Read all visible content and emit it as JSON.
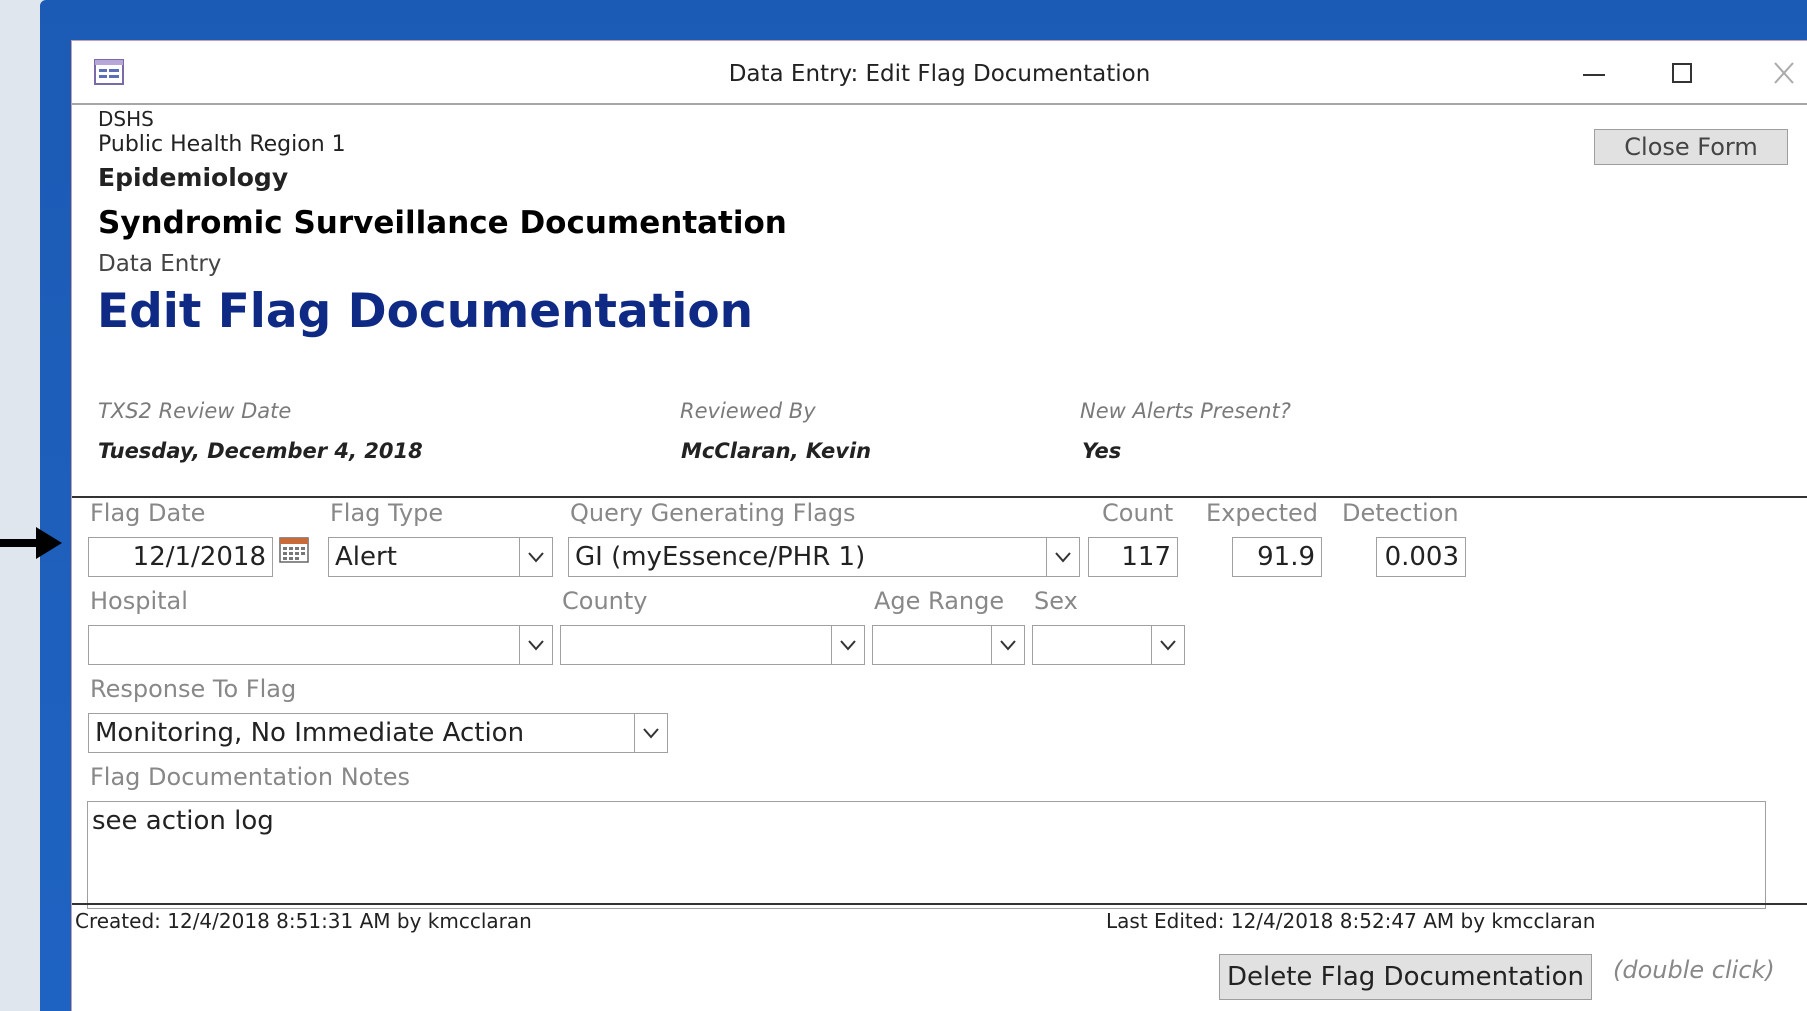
{
  "window": {
    "title": "Data Entry: Edit Flag Documentation"
  },
  "header": {
    "org": "DSHS",
    "region": "Public Health Region 1",
    "department": "Epidemiology",
    "system": "Syndromic Surveillance Documentation",
    "section": "Data Entry",
    "page_title": "Edit Flag Documentation",
    "close_button": "Close Form"
  },
  "review": {
    "review_date_label": "TXS2 Review Date",
    "review_date_value": "Tuesday, December 4, 2018",
    "reviewed_by_label": "Reviewed By",
    "reviewed_by_value": "McClaran, Kevin",
    "new_alerts_label": "New Alerts Present?",
    "new_alerts_value": "Yes"
  },
  "form": {
    "flag_date_label": "Flag Date",
    "flag_date_value": "12/1/2018",
    "flag_type_label": "Flag Type",
    "flag_type_value": "Alert",
    "query_label": "Query Generating Flags",
    "query_value": "GI (myEssence/PHR 1)",
    "count_label": "Count",
    "count_value": "117",
    "expected_label": "Expected",
    "expected_value": "91.9",
    "detection_label": "Detection",
    "detection_value": "0.003",
    "hospital_label": "Hospital",
    "hospital_value": "",
    "county_label": "County",
    "county_value": "",
    "age_range_label": "Age Range",
    "age_range_value": "",
    "sex_label": "Sex",
    "sex_value": "",
    "response_label": "Response To Flag",
    "response_value": "Monitoring, No Immediate Action",
    "notes_label": "Flag Documentation Notes",
    "notes_value": "see action log"
  },
  "footer": {
    "created": "Created: 12/4/2018 8:51:31 AM by kmcclaran",
    "last_edited": "Last Edited: 12/4/2018 8:52:47 AM by kmcclaran",
    "delete_button": "Delete Flag Documentation",
    "delete_hint": "(double click)"
  },
  "colors": {
    "frame_blue": "#1f63c2",
    "title_blue": "#0f2a84"
  },
  "icons": [
    "form-icon",
    "minimize-icon",
    "maximize-icon",
    "close-icon",
    "calendar-icon",
    "chevron-down-icon",
    "arrow-right-icon"
  ]
}
